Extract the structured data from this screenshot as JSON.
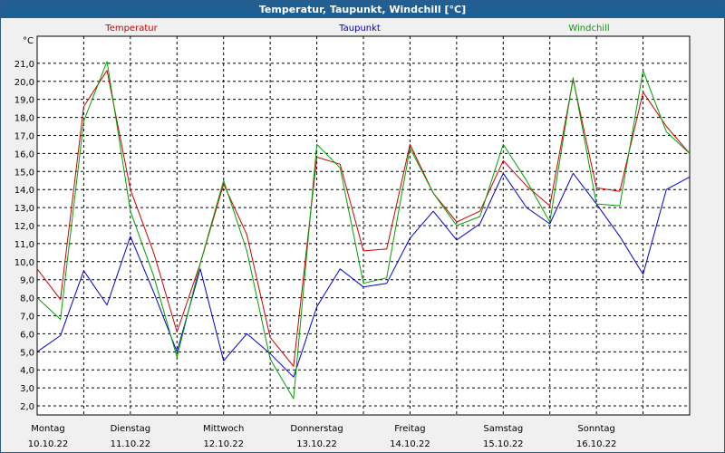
{
  "window": {
    "title": "Temperatur, Taupunkt, Windchill [°C]"
  },
  "chart_data": {
    "type": "line",
    "title": "Temperatur, Taupunkt, Windchill [°C]",
    "ylabel": "°C",
    "ylim": [
      1.5,
      22.5
    ],
    "y_ticks": [
      "2,0",
      "3,0",
      "4,0",
      "5,0",
      "6,0",
      "7,0",
      "8,0",
      "9,0",
      "10,0",
      "11,0",
      "12,0",
      "13,0",
      "14,0",
      "15,0",
      "16,0",
      "17,0",
      "18,0",
      "19,0",
      "20,0",
      "21,0"
    ],
    "x_day_labels": [
      {
        "day": "Montag",
        "date": "10.10.22"
      },
      {
        "day": "Dienstag",
        "date": "11.10.22"
      },
      {
        "day": "Mittwoch",
        "date": "12.10.22"
      },
      {
        "day": "Donnerstag",
        "date": "13.10.22"
      },
      {
        "day": "Freitag",
        "date": "14.10.22"
      },
      {
        "day": "Samstag",
        "date": "15.10.22"
      },
      {
        "day": "Sonntag",
        "date": "16.10.22"
      }
    ],
    "grid": true,
    "legend_placement": "top",
    "x_hours": [
      0,
      6,
      12,
      18,
      24,
      30,
      36,
      42,
      48,
      54,
      60,
      66,
      72,
      78,
      84,
      90,
      96,
      102,
      108,
      114,
      120,
      126,
      132,
      138,
      144,
      150,
      156,
      162,
      168
    ],
    "series": [
      {
        "name": "Temperatur",
        "color": "#cc0000",
        "values": [
          9.6,
          7.9,
          18.6,
          20.6,
          14.0,
          10.5,
          6.1,
          9.9,
          14.3,
          11.5,
          5.8,
          4.2,
          15.8,
          15.4,
          10.6,
          10.7,
          16.5,
          13.8,
          12.2,
          12.8,
          15.6,
          14.2,
          13.1,
          20.1,
          14.1,
          13.9,
          19.4,
          17.5,
          16.0
        ]
      },
      {
        "name": "Taupunkt",
        "color": "#0000cc",
        "values": [
          5.0,
          5.9,
          9.5,
          7.6,
          11.4,
          8.3,
          5.0,
          9.6,
          4.5,
          6.0,
          4.9,
          3.6,
          7.5,
          9.6,
          8.6,
          8.8,
          11.3,
          12.8,
          11.2,
          12.1,
          14.9,
          13.0,
          12.1,
          14.9,
          13.2,
          11.4,
          9.3,
          14.0,
          14.7
        ]
      },
      {
        "name": "Windchill",
        "color": "#00a000",
        "values": [
          8.0,
          6.8,
          17.8,
          21.1,
          12.8,
          9.2,
          4.7,
          9.9,
          14.5,
          10.6,
          4.6,
          2.4,
          16.5,
          15.2,
          8.8,
          9.1,
          16.3,
          13.8,
          12.0,
          12.5,
          16.5,
          14.5,
          12.2,
          20.2,
          13.2,
          13.1,
          20.6,
          17.2,
          16.0
        ]
      }
    ]
  }
}
